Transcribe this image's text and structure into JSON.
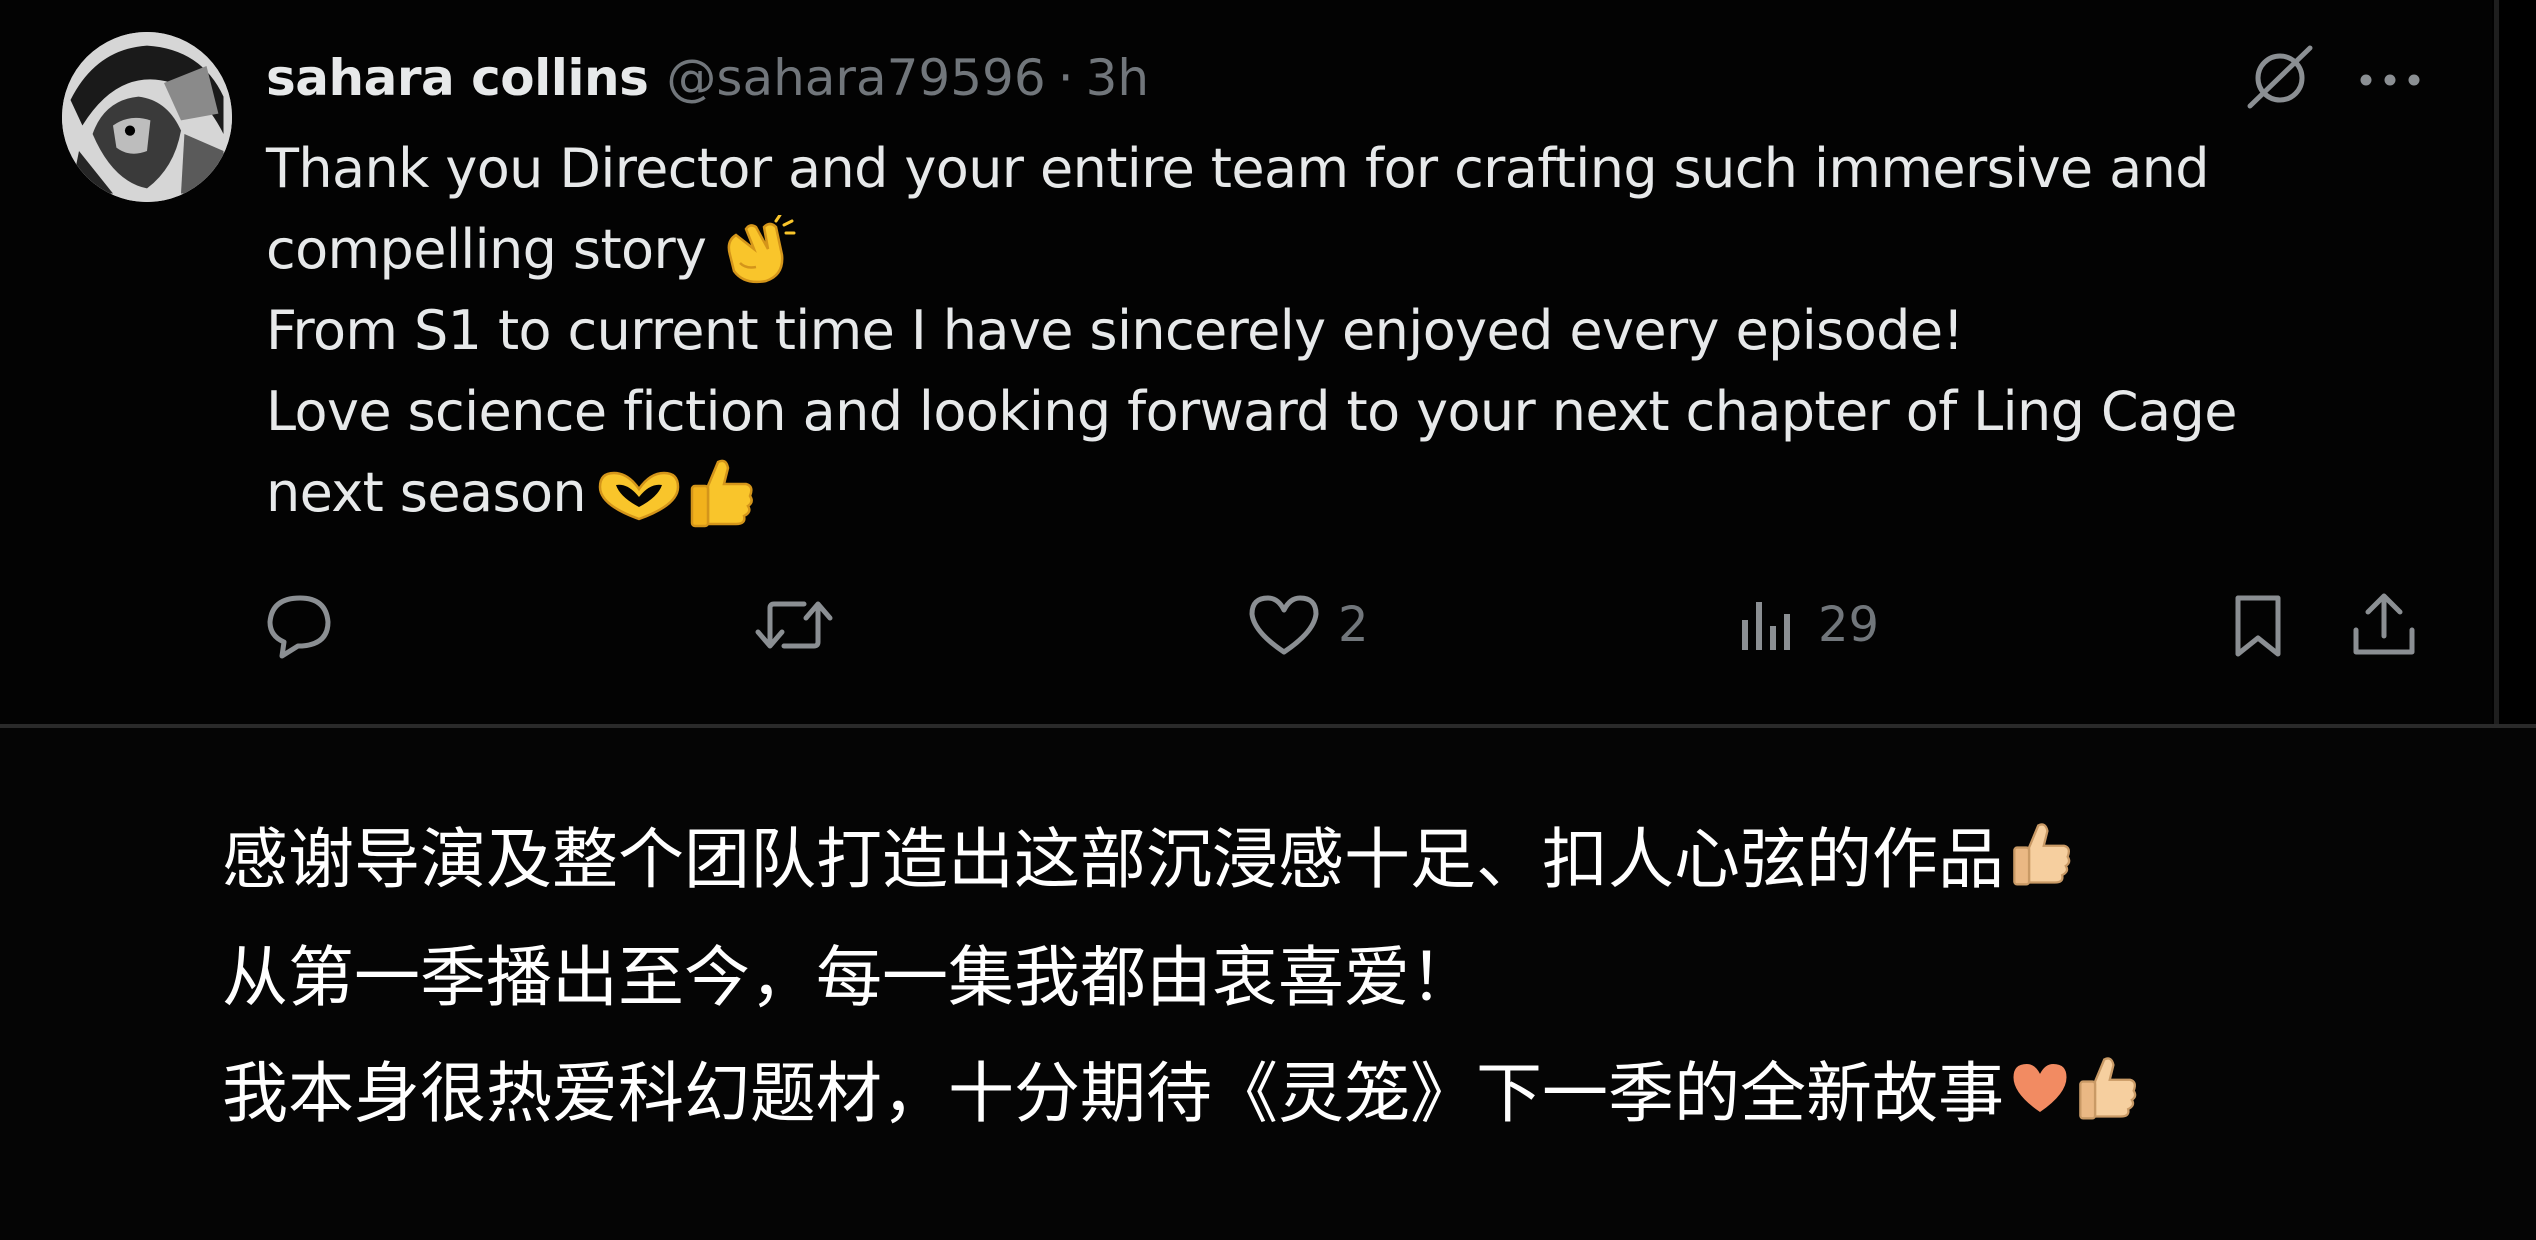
{
  "tweet": {
    "display_name": "sahara collins",
    "handle": "@sahara79596",
    "separator": "·",
    "time": "3h",
    "lines": [
      "Thank you Director and your entire team for crafting such immersive and",
      "compelling story",
      "From S1 to current time I have sincerely enjoyed every episode!",
      "Love science fiction and looking forward to your next chapter of Ling Cage",
      "next season"
    ],
    "icons": {
      "grok": "grok-icon",
      "more": "more-options-icon",
      "clap": "clapping-hands-emoji",
      "heart_hands": "heart-hands-emoji",
      "thumbs_up": "thumbs-up-emoji"
    },
    "actions": {
      "reply_count": "",
      "repost_count": "",
      "like_count": "2",
      "views_count": "29"
    }
  },
  "translation": {
    "lines": [
      "感谢导演及整个团队打造出这部沉浸感十足、扣人心弦的作品",
      "从第一季播出至今，每一集我都由衷喜爱！",
      "我本身很热爱科幻题材，十分期待《灵笼》下一季的全新故事"
    ],
    "icons": {
      "thumbs_up": "thumbs-up-emoji",
      "heart": "orange-heart-emoji"
    }
  },
  "colors": {
    "background": "#000000",
    "primary_text": "#e7e9ea",
    "secondary_text": "#71767b",
    "emoji_yellow": "#f9c52b",
    "emoji_light_skin": "#f6cf9f",
    "orange_heart": "#f28b62"
  }
}
